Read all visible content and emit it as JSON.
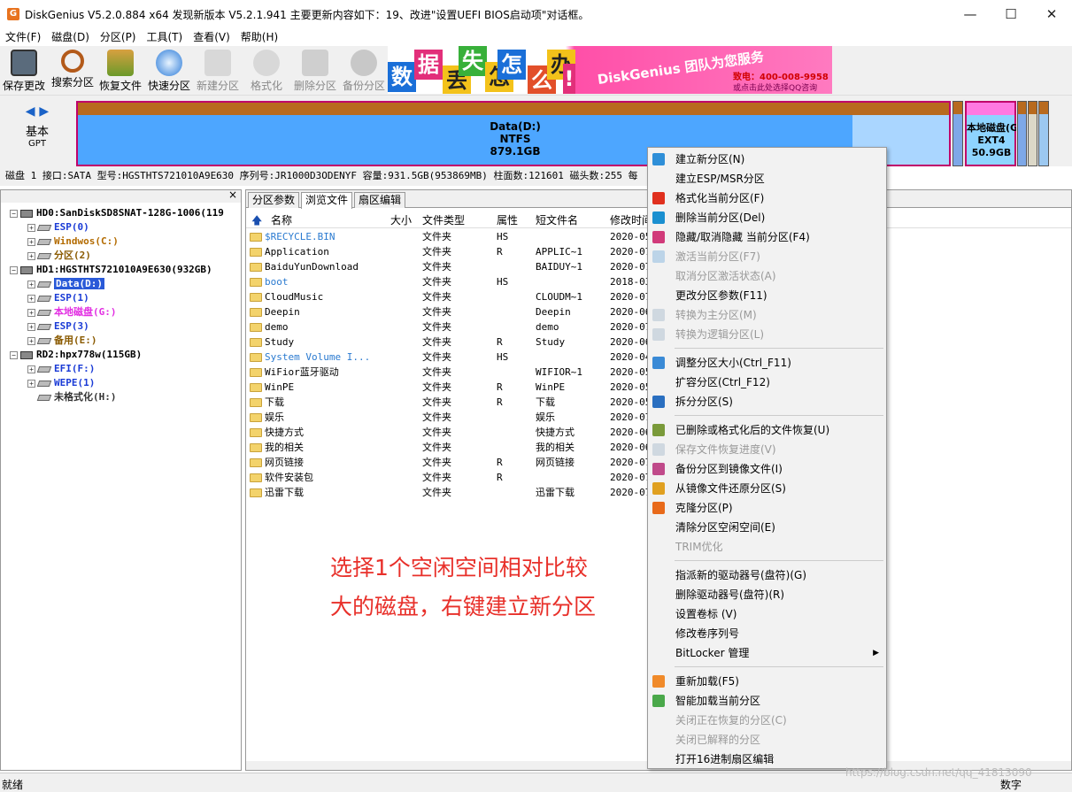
{
  "window": {
    "title": "DiskGenius V5.2.0.884 x64    发现新版本 V5.2.1.941 主要更新内容如下：19、改进\"设置UEFI BIOS启动项\"对话框。",
    "app_icon": "G",
    "minimize": "—",
    "maximize": "☐",
    "close": "✕"
  },
  "menubar": [
    "文件(F)",
    "磁盘(D)",
    "分区(P)",
    "工具(T)",
    "查看(V)",
    "帮助(H)"
  ],
  "toolbar": [
    {
      "label": "保存更改",
      "icon": "save-icon",
      "enabled": true
    },
    {
      "label": "搜索分区",
      "icon": "search-icon",
      "enabled": true
    },
    {
      "label": "恢复文件",
      "icon": "recover-icon",
      "enabled": true
    },
    {
      "label": "快速分区",
      "icon": "quick-partition-icon",
      "enabled": true
    },
    {
      "label": "新建分区",
      "icon": "new-partition-icon",
      "enabled": false
    },
    {
      "label": "格式化",
      "icon": "format-icon",
      "enabled": false
    },
    {
      "label": "删除分区",
      "icon": "delete-icon",
      "enabled": false
    },
    {
      "label": "备份分区",
      "icon": "backup-icon",
      "enabled": false
    }
  ],
  "banner": {
    "tiles": [
      "数",
      "据",
      "丢",
      "失",
      "怎",
      "么",
      "办",
      "!"
    ],
    "slogan": "DiskGenius 团队为您服务",
    "phone": "致电：400-008-9958",
    "qq": "或点击此处选择QQ咨询"
  },
  "disk_map": {
    "nav": "◀ ▶",
    "kind": "基本",
    "style": "GPT",
    "data_partition": {
      "name": "Data(D:)",
      "fs": "NTFS",
      "size": "879.1GB",
      "used_fraction": 0.889
    },
    "ext4_partition": {
      "name": "本地磁盘(G",
      "fs": "EXT4",
      "size": "50.9GB"
    }
  },
  "disk_info": "磁盘 1 接口:SATA 型号:HGSTHTS721010A9E630 序列号:JR1000D3ODENYF 容量:931.5GB(953869MB) 柱面数:121601 磁头数:255 每",
  "tree": {
    "close": "×",
    "nodes": [
      {
        "label": "HD0:SanDiskSD8SNAT-128G-1006(119",
        "level": 0,
        "type": "disk",
        "color": "#000000"
      },
      {
        "label": "ESP(0)",
        "level": 1,
        "type": "vol",
        "color": "#1a3bd6"
      },
      {
        "label": "Windwos(C:)",
        "level": 1,
        "type": "vol",
        "color": "#b36b00"
      },
      {
        "label": "分区(2)",
        "level": 1,
        "type": "vol",
        "color": "#8a5a00"
      },
      {
        "label": "HD1:HGSTHTS721010A9E630(932GB)",
        "level": 0,
        "type": "disk",
        "color": "#000000"
      },
      {
        "label": "Data(D:)",
        "level": 1,
        "type": "vol",
        "color": "#ffffff",
        "selected": true
      },
      {
        "label": "ESP(1)",
        "level": 1,
        "type": "vol",
        "color": "#1a3bd6"
      },
      {
        "label": "本地磁盘(G:)",
        "level": 1,
        "type": "vol",
        "color": "#e22fe2"
      },
      {
        "label": "ESP(3)",
        "level": 1,
        "type": "vol",
        "color": "#1a3bd6"
      },
      {
        "label": "备用(E:)",
        "level": 1,
        "type": "vol",
        "color": "#8a5a00"
      },
      {
        "label": "RD2:hpx778w(115GB)",
        "level": 0,
        "type": "disk",
        "color": "#000000"
      },
      {
        "label": "EFI(F:)",
        "level": 1,
        "type": "vol",
        "color": "#1a3bd6"
      },
      {
        "label": "WEPE(1)",
        "level": 1,
        "type": "vol",
        "color": "#1a3bd6"
      },
      {
        "label": "未格式化(H:)",
        "level": 1,
        "type": "vol",
        "color": "#333333",
        "noexp": true
      }
    ]
  },
  "tabs": [
    "分区参数",
    "浏览文件",
    "扇区编辑"
  ],
  "active_tab": 1,
  "columns": [
    "名称",
    "大小",
    "文件类型",
    "属性",
    "短文件名",
    "修改时间"
  ],
  "up_icon": "🡅",
  "files": [
    {
      "name": "$RECYCLE.BIN",
      "type": "文件夹",
      "attr": "HS",
      "short": "",
      "date": "2020-05",
      "blue": true
    },
    {
      "name": "Application",
      "type": "文件夹",
      "attr": "R",
      "short": "APPLIC~1",
      "date": "2020-07"
    },
    {
      "name": "BaiduYunDownload",
      "type": "文件夹",
      "attr": "",
      "short": "BAIDUY~1",
      "date": "2020-07"
    },
    {
      "name": "boot",
      "type": "文件夹",
      "attr": "HS",
      "short": "",
      "date": "2018-03",
      "blue": true
    },
    {
      "name": "CloudMusic",
      "type": "文件夹",
      "attr": "",
      "short": "CLOUDM~1",
      "date": "2020-07"
    },
    {
      "name": "Deepin",
      "type": "文件夹",
      "attr": "",
      "short": "Deepin",
      "date": "2020-06"
    },
    {
      "name": "demo",
      "type": "文件夹",
      "attr": "",
      "short": "demo",
      "date": "2020-07"
    },
    {
      "name": "Study",
      "type": "文件夹",
      "attr": "R",
      "short": "Study",
      "date": "2020-06"
    },
    {
      "name": "System Volume I...",
      "type": "文件夹",
      "attr": "HS",
      "short": "",
      "date": "2020-04",
      "blue": true
    },
    {
      "name": "WiFior蓝牙驱动",
      "type": "文件夹",
      "attr": "",
      "short": "WIFIOR~1",
      "date": "2020-05"
    },
    {
      "name": "WinPE",
      "type": "文件夹",
      "attr": "R",
      "short": "WinPE",
      "date": "2020-05"
    },
    {
      "name": "下载",
      "type": "文件夹",
      "attr": "R",
      "short": "下载",
      "date": "2020-05"
    },
    {
      "name": "娱乐",
      "type": "文件夹",
      "attr": "",
      "short": "娱乐",
      "date": "2020-07"
    },
    {
      "name": "快捷方式",
      "type": "文件夹",
      "attr": "",
      "short": "快捷方式",
      "date": "2020-06"
    },
    {
      "name": "我的相关",
      "type": "文件夹",
      "attr": "",
      "short": "我的相关",
      "date": "2020-06"
    },
    {
      "name": "网页链接",
      "type": "文件夹",
      "attr": "R",
      "short": "网页链接",
      "date": "2020-07"
    },
    {
      "name": "软件安装包",
      "type": "文件夹",
      "attr": "R",
      "short": "",
      "date": "2020-07"
    },
    {
      "name": "迅雷下载",
      "type": "文件夹",
      "attr": "",
      "short": "迅雷下载",
      "date": "2020-07"
    }
  ],
  "annotation": [
    "选择1个空闲空间相对比较",
    "大的磁盘，右键建立新分区"
  ],
  "context_menu": [
    {
      "label": "建立新分区(N)",
      "icon": "new-partition-icon",
      "color": "#2f8fd8",
      "enabled": true
    },
    {
      "label": "建立ESP/MSR分区",
      "icon": "",
      "enabled": true
    },
    {
      "label": "格式化当前分区(F)",
      "icon": "format-icon",
      "color": "#e0301e",
      "enabled": true
    },
    {
      "label": "删除当前分区(Del)",
      "icon": "delete-icon",
      "color": "#1a8fd0",
      "enabled": true
    },
    {
      "label": "隐藏/取消隐藏 当前分区(F4)",
      "icon": "hide-icon",
      "color": "#d13a7a",
      "enabled": true
    },
    {
      "label": "激活当前分区(F7)",
      "icon": "activate-icon",
      "color": "#bcd4e8",
      "enabled": false
    },
    {
      "label": "取消分区激活状态(A)",
      "icon": "",
      "enabled": false
    },
    {
      "label": "更改分区参数(F11)",
      "icon": "",
      "enabled": true
    },
    {
      "label": "转换为主分区(M)",
      "icon": "convert-primary-icon",
      "color": "#cfd8e0",
      "enabled": false
    },
    {
      "label": "转换为逻辑分区(L)",
      "icon": "convert-logical-icon",
      "color": "#cfd8e0",
      "enabled": false,
      "sep_after": true
    },
    {
      "label": "调整分区大小(Ctrl_F11)",
      "icon": "resize-icon",
      "color": "#3a8ad6",
      "enabled": true
    },
    {
      "label": "扩容分区(Ctrl_F12)",
      "icon": "",
      "enabled": true
    },
    {
      "label": "拆分分区(S)",
      "icon": "split-icon",
      "color": "#2a6fc0",
      "enabled": true,
      "sep_after": true
    },
    {
      "label": "已删除或格式化后的文件恢复(U)",
      "icon": "recover-icon",
      "color": "#7a9a3a",
      "enabled": true
    },
    {
      "label": "保存文件恢复进度(V)",
      "icon": "save-progress-icon",
      "color": "#cfd8e0",
      "enabled": false
    },
    {
      "label": "备份分区到镜像文件(I)",
      "icon": "backup-icon",
      "color": "#c04a8a",
      "enabled": true
    },
    {
      "label": "从镜像文件还原分区(S)",
      "icon": "restore-icon",
      "color": "#e0a020",
      "enabled": true
    },
    {
      "label": "克隆分区(P)",
      "icon": "clone-icon",
      "color": "#e86a1a",
      "enabled": true
    },
    {
      "label": "清除分区空闲空间(E)",
      "icon": "",
      "enabled": true
    },
    {
      "label": "TRIM优化",
      "icon": "",
      "enabled": false,
      "sep_after": true
    },
    {
      "label": "指派新的驱动器号(盘符)(G)",
      "icon": "",
      "enabled": true
    },
    {
      "label": "删除驱动器号(盘符)(R)",
      "icon": "",
      "enabled": true
    },
    {
      "label": "设置卷标 (V)",
      "icon": "",
      "enabled": true
    },
    {
      "label": "修改卷序列号",
      "icon": "",
      "enabled": true
    },
    {
      "label": "BitLocker 管理",
      "icon": "",
      "enabled": true,
      "submenu": true,
      "sep_after": true
    },
    {
      "label": "重新加载(F5)",
      "icon": "reload-icon",
      "color": "#f08a2a",
      "enabled": true
    },
    {
      "label": "智能加载当前分区",
      "icon": "smart-load-icon",
      "color": "#4aa84a",
      "enabled": true
    },
    {
      "label": "关闭正在恢复的分区(C)",
      "icon": "",
      "enabled": false
    },
    {
      "label": "关闭已解释的分区",
      "icon": "",
      "enabled": false
    },
    {
      "label": "打开16进制扇区编辑",
      "icon": "",
      "enabled": true
    }
  ],
  "status": {
    "left": "就绪",
    "right": "数字"
  },
  "watermark": "https://blog.csdn.net/qq_41813090"
}
